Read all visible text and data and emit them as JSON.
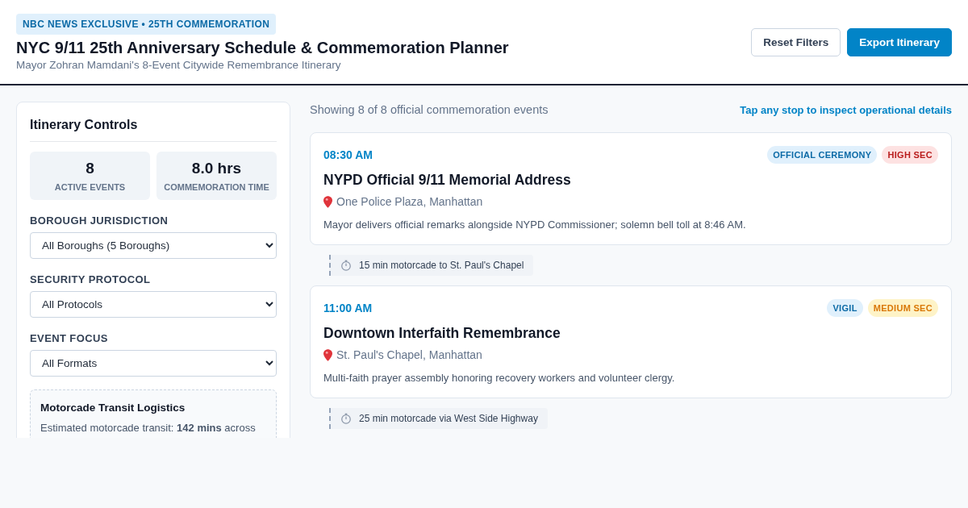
{
  "header": {
    "badge": "NBC NEWS EXCLUSIVE • 25TH COMMEMORATION",
    "title": "NYC 9/11 25th Anniversary Schedule & Commemoration Planner",
    "subtitle": "Mayor Zohran Mamdani's 8-Event Citywide Remembrance Itinerary",
    "buttons": [
      {
        "label": "Reset Filters",
        "kind": "secondary"
      },
      {
        "label": "Export Itinerary",
        "kind": "primary"
      }
    ]
  },
  "sidebar": {
    "title": "Itinerary Controls",
    "stats": [
      {
        "value": "8",
        "label": "ACTIVE EVENTS"
      },
      {
        "value": "8.0 hrs",
        "label": "COMMEMORATION TIME"
      }
    ],
    "filters": [
      {
        "label": "BOROUGH JURISDICTION",
        "value": "All Boroughs (5 Boroughs)"
      },
      {
        "label": "SECURITY PROTOCOL",
        "value": "All Protocols"
      },
      {
        "label": "EVENT FOCUS",
        "value": "All Formats"
      }
    ],
    "logistics": {
      "title": "Motorcade Transit Logistics",
      "text": "Estimated motorcade transit: **142 mins** across"
    }
  },
  "main": {
    "summary": "Showing 8 of 8 official commemoration events",
    "hint": "Tap any stop to inspect operational details",
    "items": [
      {
        "kind": "event",
        "time": "08:30 AM",
        "tags": [
          {
            "label": "OFFICIAL CEREMONY",
            "kind": "category"
          },
          {
            "label": "HIGH SEC",
            "kind": "high"
          }
        ],
        "title": "NYPD Official 9/11 Memorial Address",
        "location": "One Police Plaza, Manhattan",
        "description": "Mayor delivers official remarks alongside NYPD Commissioner; solemn bell toll at 8:46 AM."
      },
      {
        "kind": "transit",
        "text": "15 min motorcade to St. Paul's Chapel"
      },
      {
        "kind": "event",
        "time": "11:00 AM",
        "tags": [
          {
            "label": "VIGIL",
            "kind": "category"
          },
          {
            "label": "MEDIUM SEC",
            "kind": "medium"
          }
        ],
        "title": "Downtown Interfaith Remembrance",
        "location": "St. Paul's Chapel, Manhattan",
        "description": "Multi-faith prayer assembly honoring recovery workers and volunteer clergy."
      },
      {
        "kind": "transit",
        "text": "25 min motorcade via West Side Highway"
      }
    ]
  }
}
